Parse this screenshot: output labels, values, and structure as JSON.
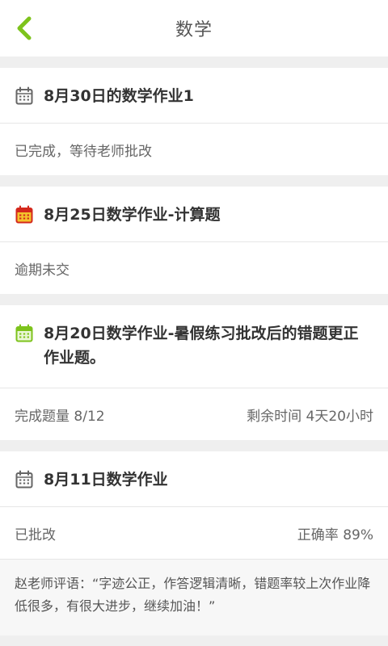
{
  "header": {
    "title": "数学",
    "back_icon": "chevron-left-icon",
    "accent": "#7dc31c"
  },
  "cards": [
    {
      "title": "8月30日的数学作业1",
      "icon": "calendar-icon",
      "icon_color": "#666666",
      "status": "已完成，等待老师批改"
    },
    {
      "title": "8月25日数学作业-计算题",
      "icon": "calendar-icon",
      "icon_color": "#d4281c",
      "icon_fill": "#f3c42c",
      "status": "逾期未交"
    },
    {
      "title": "8月20日数学作业-暑假练习批改后的错题更正作业题。",
      "icon": "calendar-icon",
      "icon_color": "#7dc31c",
      "left": "完成题量 8/12",
      "right": "剩余时间 4天20小时"
    },
    {
      "title": "8月11日数学作业",
      "icon": "calendar-icon",
      "icon_color": "#666666",
      "left": "已批改",
      "right": "正确率 89%",
      "comment": "赵老师评语：“字迹公正，作答逻辑清晰，错题率较上次作业降低很多，有很大进步，继续加油！”"
    }
  ]
}
